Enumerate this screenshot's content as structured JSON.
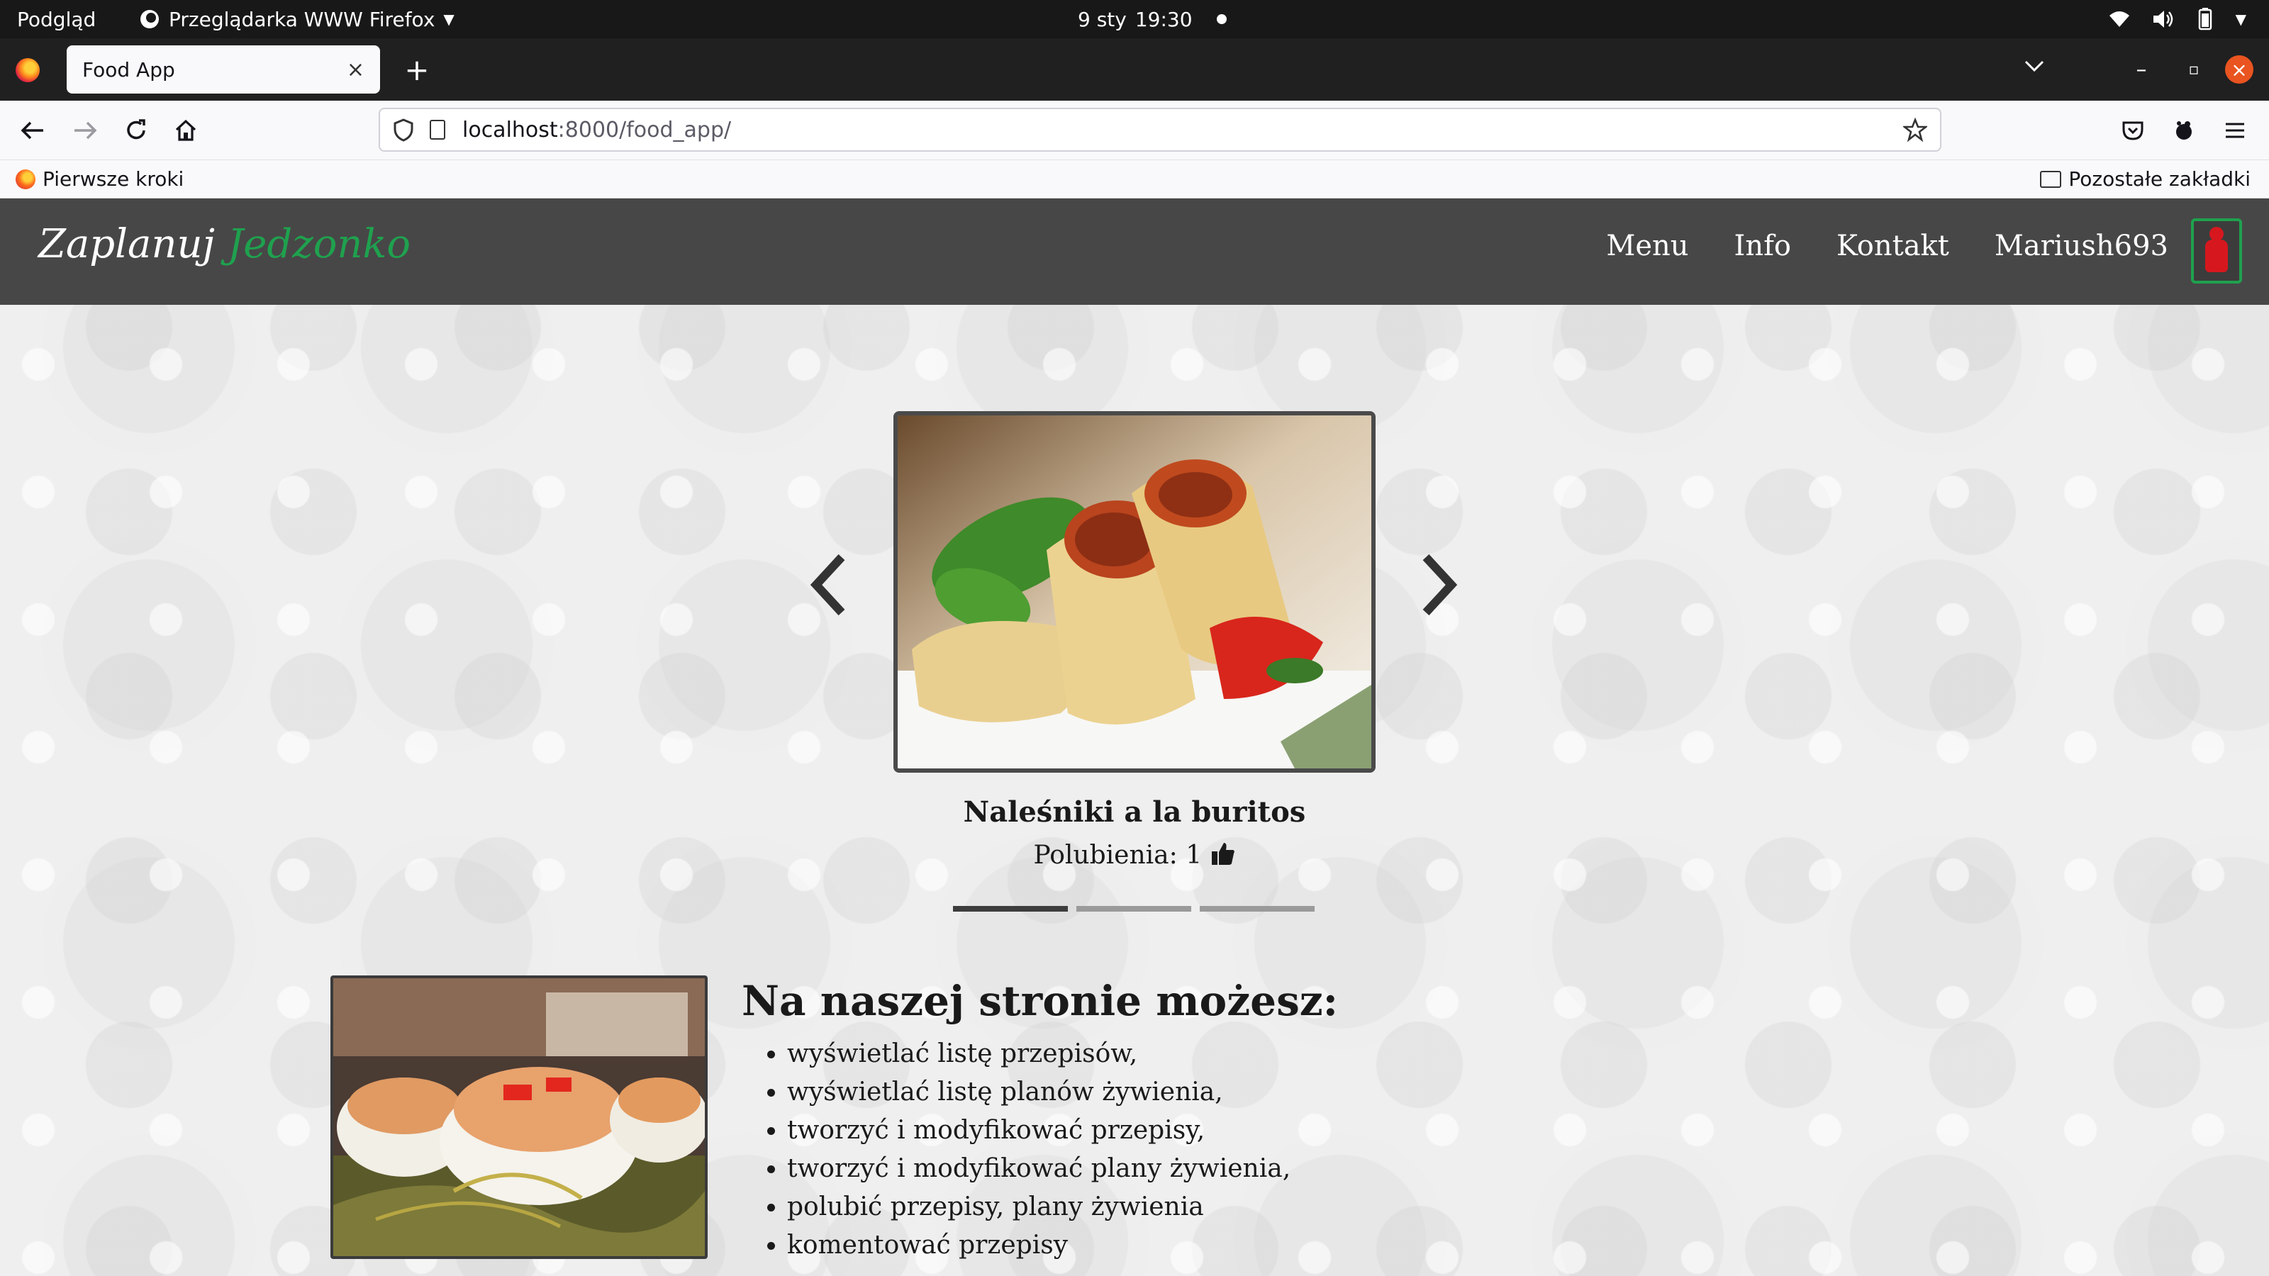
{
  "system_bar": {
    "activities": "Podgląd",
    "app_name": "Przeglądarka WWW Firefox",
    "date": "9 sty",
    "time": "19:30"
  },
  "browser": {
    "tab_title": "Food App",
    "url_host": "localhost",
    "url_path": ":8000/food_app/",
    "bookmark_left": "Pierwsze kroki",
    "bookmark_right": "Pozostałe zakładki"
  },
  "site": {
    "logo_part1": "Zaplanuj",
    "logo_part2": "Jedzonko",
    "nav": {
      "menu": "Menu",
      "info": "Info",
      "contact": "Kontakt",
      "user": "Mariush693"
    },
    "accent_color": "#1fa14e",
    "header_color": "#474747"
  },
  "carousel": {
    "title": "Naleśniki a la buritos",
    "likes_label": "Polubienia: 1",
    "slide_count": 3,
    "active_index": 0
  },
  "info": {
    "heading": "Na naszej stronie możesz:",
    "items": [
      "wyświetlać listę przepisów,",
      "wyświetlać listę planów żywienia,",
      "tworzyć i modyfikować przepisy,",
      "tworzyć i modyfikować plany żywienia,",
      "polubić przepisy, plany żywienia",
      "komentować przepisy"
    ]
  }
}
